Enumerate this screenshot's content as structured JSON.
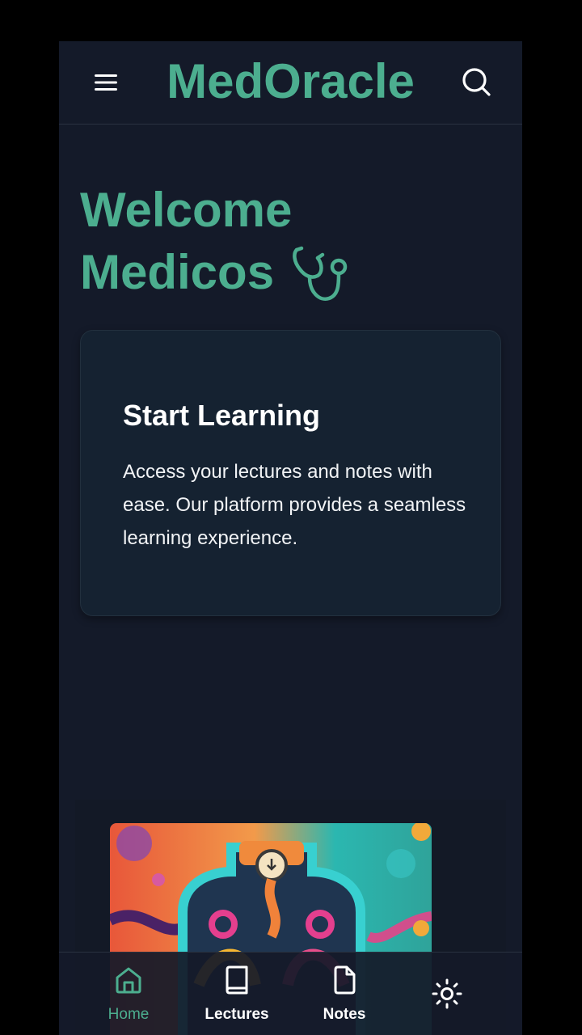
{
  "header": {
    "title": "MedOracle",
    "menu_icon": "hamburger-menu-icon",
    "search_icon": "search-icon"
  },
  "hero": {
    "line1": "Welcome",
    "line2": "Medicos",
    "icon": "stethoscope-icon"
  },
  "card": {
    "title": "Start Learning",
    "body": "Access your lectures and notes with ease. Our platform provides a seamless learning experience."
  },
  "bottom_nav": {
    "items": [
      {
        "label": "Home",
        "icon": "home-icon",
        "active": true
      },
      {
        "label": "Lectures",
        "icon": "book-icon",
        "active": false
      },
      {
        "label": "Notes",
        "icon": "file-icon",
        "active": false
      }
    ],
    "theme_icon": "sun-icon"
  },
  "colors": {
    "background": "#141a29",
    "accent": "#4cae8f",
    "card": "#152231",
    "text": "#ffffff"
  }
}
